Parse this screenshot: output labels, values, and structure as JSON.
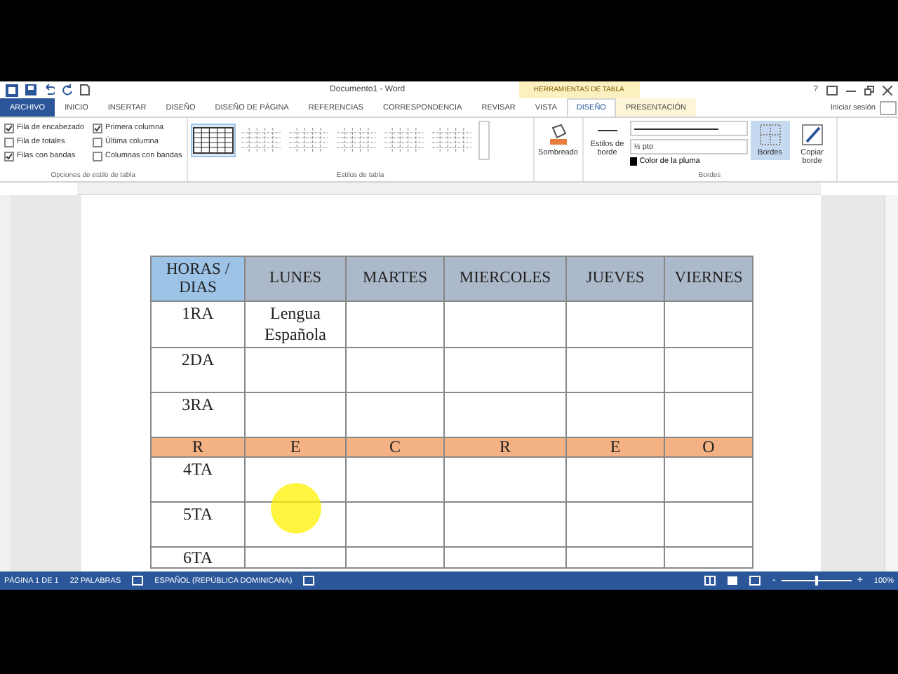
{
  "title_bar": {
    "title": "Documento1 - Word",
    "contextual_label": "HERRAMIENTAS DE TABLA",
    "help": "?",
    "sign_in": "Iniciar sesión"
  },
  "tabs": [
    {
      "label": "ARCHIVO",
      "kind": "file",
      "selected": false
    },
    {
      "label": "INICIO",
      "kind": "tab",
      "selected": false
    },
    {
      "label": "INSERTAR",
      "kind": "tab",
      "selected": false
    },
    {
      "label": "DISEÑO",
      "kind": "tab",
      "selected": false
    },
    {
      "label": "DISEÑO DE PÁGINA",
      "kind": "tab",
      "selected": false
    },
    {
      "label": "REFERENCIAS",
      "kind": "tab",
      "selected": false
    },
    {
      "label": "CORRESPONDENCIA",
      "kind": "tab",
      "selected": false
    },
    {
      "label": "REVISAR",
      "kind": "tab",
      "selected": false
    },
    {
      "label": "VISTA",
      "kind": "tab",
      "selected": false
    },
    {
      "label": "DISEÑO",
      "kind": "contextual",
      "selected": true
    },
    {
      "label": "PRESENTACIÓN",
      "kind": "contextual",
      "selected": false
    }
  ],
  "ribbon": {
    "style_options": {
      "label": "Opciones de estilo de tabla",
      "options": [
        {
          "label": "Fila de encabezado",
          "checked": true
        },
        {
          "label": "Fila de totales",
          "checked": false
        },
        {
          "label": "Filas con bandas",
          "checked": true
        },
        {
          "label": "Primera columna",
          "checked": true
        },
        {
          "label": "Última columna",
          "checked": false
        },
        {
          "label": "Columnas con bandas",
          "checked": false
        }
      ]
    },
    "table_styles": {
      "label": "Estilos de tabla"
    },
    "shading": {
      "label": "Sombreado"
    },
    "borders": {
      "label": "Bordes",
      "border_styles": "Estilos de borde",
      "weight": "½ pto",
      "pen_color": "Color de la pluma",
      "borders_button": "Bordes",
      "border_painter": "Copiar borde"
    }
  },
  "table": {
    "columns": [
      "HORAS / DIAS",
      "LUNES",
      "MARTES",
      "MIERCOLES",
      "JUEVES",
      "VIERNES"
    ],
    "rows": [
      {
        "kind": "normal",
        "cells": [
          "1RA",
          "Lengua Española",
          "",
          "",
          "",
          ""
        ]
      },
      {
        "kind": "normal",
        "cells": [
          "2DA",
          "",
          "",
          "",
          "",
          ""
        ]
      },
      {
        "kind": "normal",
        "cells": [
          "3RA",
          "",
          "",
          "",
          "",
          ""
        ]
      },
      {
        "kind": "break",
        "cells": [
          "R",
          "E",
          "C",
          "R",
          "E",
          "O"
        ]
      },
      {
        "kind": "normal",
        "cells": [
          "4TA",
          "",
          "",
          "",
          "",
          ""
        ]
      },
      {
        "kind": "normal",
        "cells": [
          "5TA",
          "",
          "",
          "",
          "",
          ""
        ]
      },
      {
        "kind": "short",
        "cells": [
          "6TA",
          "",
          "",
          "",
          "",
          ""
        ]
      }
    ]
  },
  "status_bar": {
    "page": "PÁGINA 1 DE 1",
    "words": "22 PALABRAS",
    "language": "ESPAÑOL (REPÚBLICA DOMINICANA)",
    "zoom": {
      "minus": "-",
      "plus": "+",
      "level": 0.5,
      "reading": "100%"
    }
  }
}
